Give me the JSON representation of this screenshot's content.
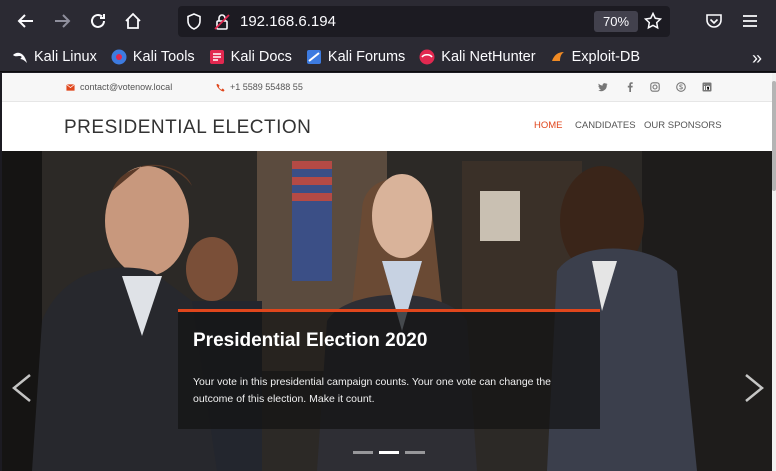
{
  "browser": {
    "url": "192.168.6.194",
    "zoom": "70%",
    "bookmarks": [
      {
        "label": "Kali Linux",
        "icon": "kali-dragon-icon"
      },
      {
        "label": "Kali Tools",
        "icon": "kali-tools-icon"
      },
      {
        "label": "Kali Docs",
        "icon": "kali-docs-icon"
      },
      {
        "label": "Kali Forums",
        "icon": "kali-forums-icon"
      },
      {
        "label": "Kali NetHunter",
        "icon": "nethunter-icon"
      },
      {
        "label": "Exploit-DB",
        "icon": "exploit-db-icon"
      }
    ],
    "more": "»"
  },
  "site": {
    "email": "contact@votenow.local",
    "phone": "+1 5589 55488 55",
    "brand": "PRESIDENTIAL ELECTION",
    "menu": [
      "HOME",
      "CANDIDATES",
      "OUR SPONSORS"
    ],
    "accent": "#e0461c",
    "hero": {
      "title": "Presidential Election 2020",
      "description": "Your vote in this presidential campaign counts. Your one vote can change the outcome of this election. Make it count."
    }
  }
}
